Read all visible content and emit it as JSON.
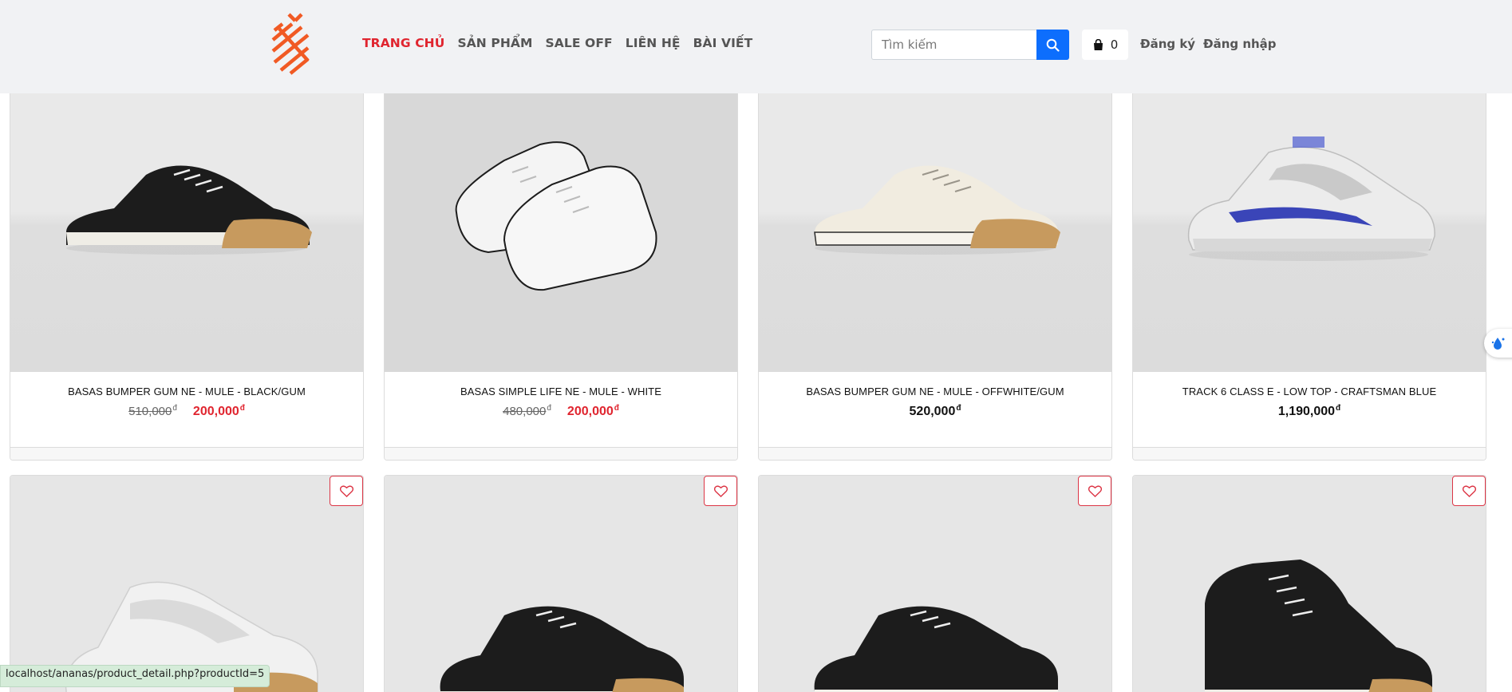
{
  "header": {
    "nav": [
      "TRANG CHỦ",
      "SẢN PHẨM",
      "SALE OFF",
      "LIÊN HỆ",
      "BÀI VIẾT"
    ],
    "search_placeholder": "Tìm kiếm",
    "cart_count": "0",
    "register": "Đăng ký",
    "login": "Đăng nhập"
  },
  "products": [
    {
      "name": "BASAS BUMPER GUM NE - MULE - BLACK/GUM",
      "old_price": "510,000",
      "price": "200,000",
      "currency": "đ"
    },
    {
      "name": "BASAS SIMPLE LIFE NE - MULE - WHITE",
      "old_price": "480,000",
      "price": "200,000",
      "currency": "đ"
    },
    {
      "name": "BASAS BUMPER GUM NE - MULE - OFFWHITE/GUM",
      "price": "520,000",
      "currency": "đ"
    },
    {
      "name": "TRACK 6 CLASS E - LOW TOP - CRAFTSMAN BLUE",
      "price": "1,190,000",
      "currency": "đ"
    }
  ],
  "status_url": "localhost/ananas/product_detail.php?productId=5",
  "colors": {
    "accent": "#e0252f",
    "brand_orange": "#f15a24",
    "search_button": "#0d6efd",
    "header_bg": "#f1f2f4"
  },
  "icons": [
    "logo-icon",
    "search-icon",
    "shopping-bag-icon",
    "heart-icon",
    "water-drop-icon"
  ]
}
